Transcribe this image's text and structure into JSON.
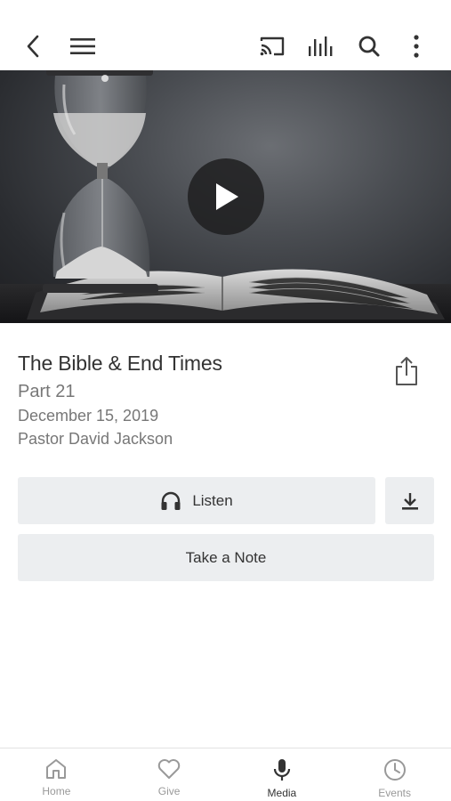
{
  "header": {
    "icons": [
      "back-icon",
      "menu-icon",
      "cast-icon",
      "equalizer-icon",
      "search-icon",
      "more-vertical-icon"
    ]
  },
  "hero": {
    "icon": "play-icon"
  },
  "sermon": {
    "title": "The Bible & End Times",
    "part": "Part 21",
    "date": "December 15, 2019",
    "speaker": "Pastor David Jackson"
  },
  "actions": {
    "listen_label": "Listen",
    "note_label": "Take a Note"
  },
  "tabbar": {
    "tabs": [
      {
        "label": "Home",
        "icon": "home-icon"
      },
      {
        "label": "Give",
        "icon": "heart-icon"
      },
      {
        "label": "Media",
        "icon": "microphone-icon",
        "active": true
      },
      {
        "label": "Events",
        "icon": "clock-icon"
      }
    ]
  },
  "colors": {
    "text_primary": "#333333",
    "text_secondary": "#777777",
    "button_bg": "#eceef0",
    "tab_inactive": "#999999"
  }
}
